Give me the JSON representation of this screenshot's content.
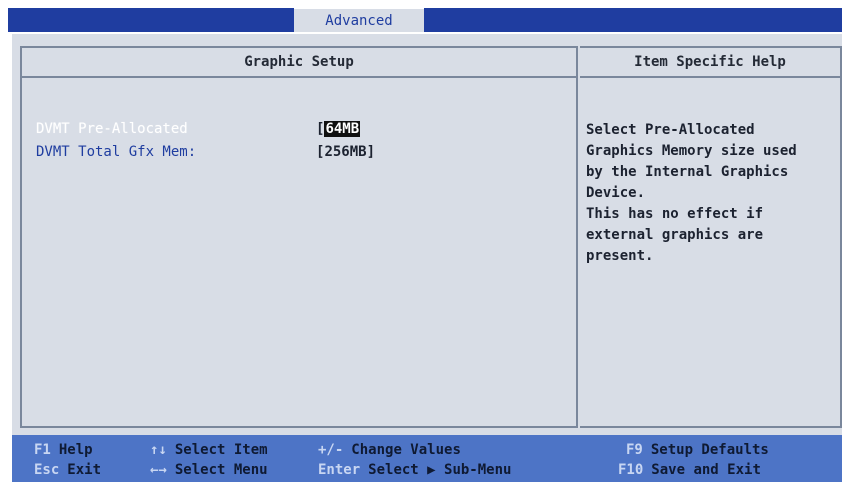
{
  "menu": {
    "active_tab": "Advanced"
  },
  "main_panel": {
    "title": "Graphic Setup",
    "items": [
      {
        "label": "DVMT Pre-Allocated",
        "bracket_open": "[",
        "value": "64MB",
        "bracket_close": ""
      },
      {
        "label": "DVMT Total Gfx Mem:",
        "bracket_open": "[",
        "value": "256MB",
        "bracket_close": "]"
      }
    ]
  },
  "help_panel": {
    "title": "Item Specific Help",
    "text": "Select Pre-Allocated\nGraphics Memory size used\nby the Internal Graphics\nDevice.\nThis has no effect if\nexternal graphics are\npresent."
  },
  "footer": {
    "row1": [
      {
        "key": "F1",
        "action": "Help"
      },
      {
        "key": "↑↓",
        "action": "Select Item"
      },
      {
        "key": "+/-",
        "action": "Change Values"
      },
      {
        "key": "F9",
        "action": "Setup Defaults"
      }
    ],
    "row2": [
      {
        "key": "Esc",
        "action": "Exit"
      },
      {
        "key": "←→",
        "action": "Select Menu"
      },
      {
        "key": "Enter",
        "action": "Select ▶ Sub-Menu"
      },
      {
        "key": "F10",
        "action": "Save and Exit"
      }
    ]
  },
  "colors": {
    "bios_blue": "#1f3da0",
    "panel_gray": "#d8dde6",
    "footer_blue": "#4d74c6"
  }
}
